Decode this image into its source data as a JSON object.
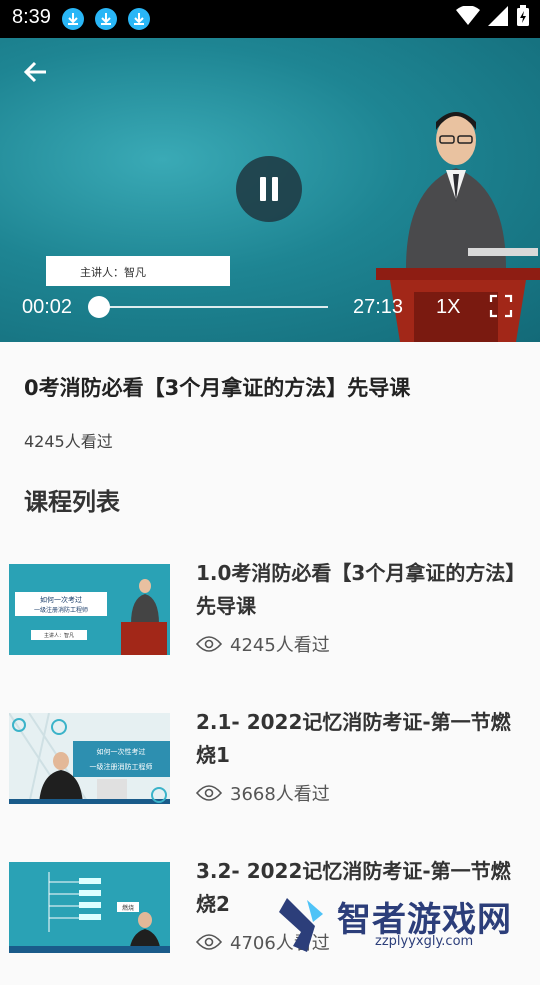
{
  "status_bar": {
    "time": "8:39"
  },
  "player": {
    "lecturer_caption": "主讲人：智凡",
    "current_time": "00:02",
    "total_time": "27:13",
    "speed": "1X",
    "progress_fraction": 0.0012
  },
  "course": {
    "title": "0考消防必看【3个月拿证的方法】先导课",
    "views": "4245人看过"
  },
  "section_title": "课程列表",
  "lessons": [
    {
      "title": "1.0考消防必看【3个月拿证的方法】先导课",
      "views": "4245人看过"
    },
    {
      "title": "2.1- 2022记忆消防考证-第一节燃烧1",
      "views": "3668人看过"
    },
    {
      "title": "3.2- 2022记忆消防考证-第一节燃烧2",
      "views": "4706人看过"
    }
  ],
  "thumbnails": {
    "t1_line1": "如何一次考过",
    "t1_line2": "一级注册消防工程师",
    "t1_caption": "主讲人：智凡",
    "t2_line1": "如何一次性考过",
    "t2_line2": "一级注册消防工程师",
    "t3_tag": "燃烧"
  },
  "watermark": {
    "name": "智者游戏网",
    "url": "zzplyyxgly.com"
  },
  "colors": {
    "player_bg": "#1e8593",
    "accent": "#29b6f6"
  }
}
